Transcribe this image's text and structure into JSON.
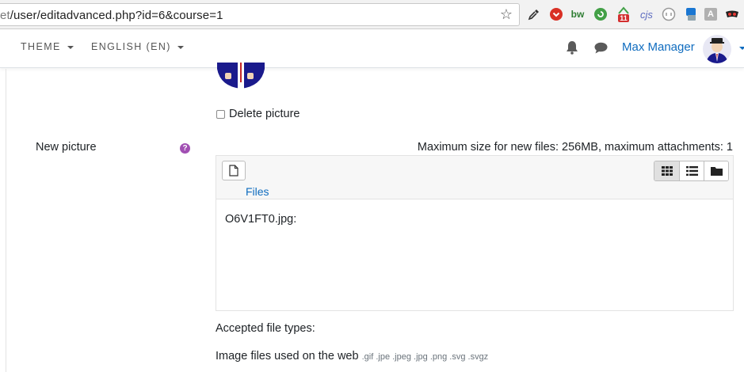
{
  "browser": {
    "url_prefix": "et",
    "url_path": "/user/editadvanced.php?id=6&course=1",
    "extensions": [
      "eyedropper-icon",
      "stop-icon",
      "bw-icon",
      "refresh-icon",
      "home-badge-icon",
      "cjs-icon",
      "circle-icon",
      "translate-icon",
      "a-icon",
      "mask-icon"
    ],
    "ext_texts": {
      "bw": "bw",
      "badge_count": "11",
      "cjs": "cjs",
      "a": "A"
    }
  },
  "navbar": {
    "theme_label": "THEME",
    "language_label": "ENGLISH (EN)",
    "user_name": "Max Manager"
  },
  "form": {
    "delete_picture_label": "Delete picture",
    "new_picture_label": "New picture",
    "max_size_text": "Maximum size for new files: 256MB, maximum attachments: 1",
    "files_label": "Files",
    "file_name": "O6V1FT0.jpg:",
    "accepted_types_title": "Accepted file types:",
    "accepted_types_desc": "Image files used on the web",
    "accepted_types_ext": ".gif .jpe .jpeg .jpg .png .svg .svgz"
  },
  "colors": {
    "link_blue": "#0f6cbf",
    "help_purple": "#a14fb3",
    "avatar_bg": "#1a1a8c"
  }
}
